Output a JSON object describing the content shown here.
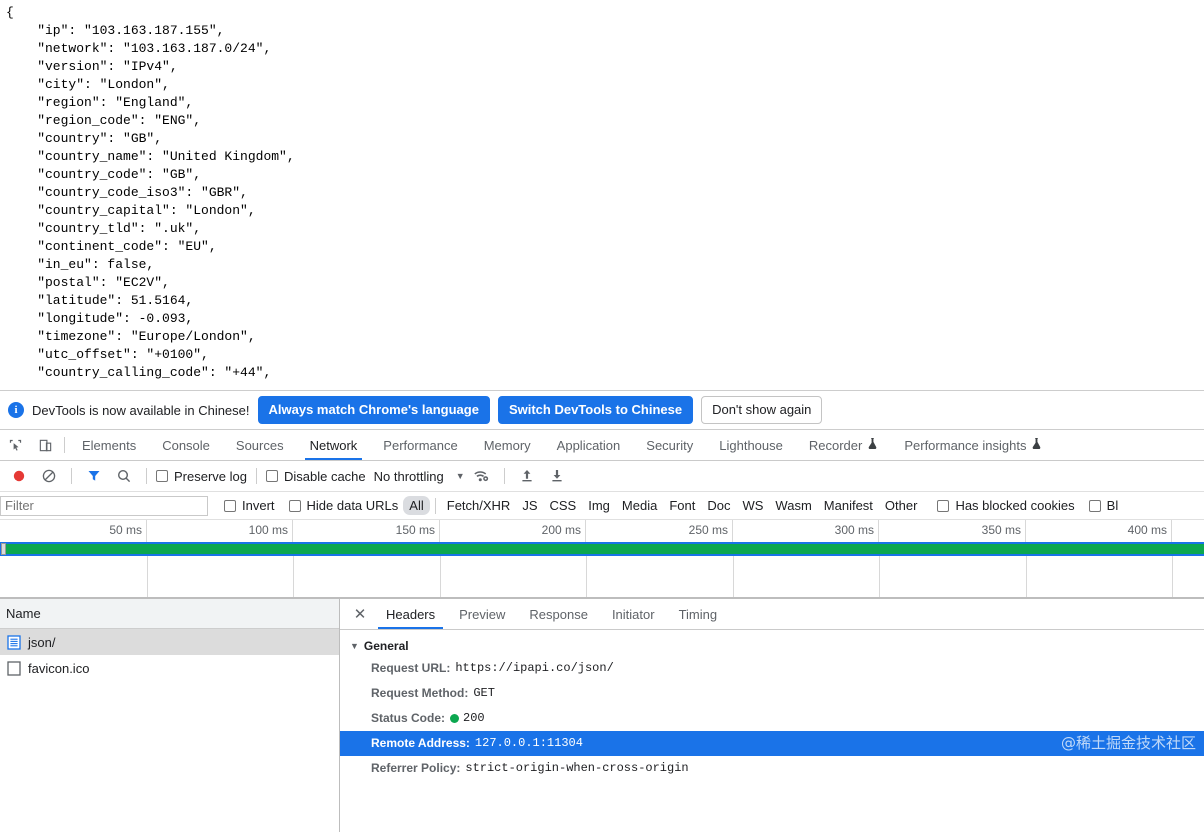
{
  "page": {
    "json_response": "{\n    \"ip\": \"103.163.187.155\",\n    \"network\": \"103.163.187.0/24\",\n    \"version\": \"IPv4\",\n    \"city\": \"London\",\n    \"region\": \"England\",\n    \"region_code\": \"ENG\",\n    \"country\": \"GB\",\n    \"country_name\": \"United Kingdom\",\n    \"country_code\": \"GB\",\n    \"country_code_iso3\": \"GBR\",\n    \"country_capital\": \"London\",\n    \"country_tld\": \".uk\",\n    \"continent_code\": \"EU\",\n    \"in_eu\": false,\n    \"postal\": \"EC2V\",\n    \"latitude\": 51.5164,\n    \"longitude\": -0.093,\n    \"timezone\": \"Europe/London\",\n    \"utc_offset\": \"+0100\",\n    \"country_calling_code\": \"+44\","
  },
  "infobar": {
    "icon": "info-icon",
    "message": "DevTools is now available in Chinese!",
    "primary_button": "Always match Chrome's language",
    "secondary_button": "Switch DevTools to Chinese",
    "dismiss_button": "Don't show again"
  },
  "devtools": {
    "left_icons": [
      "inspect-icon",
      "device-toolbar-icon"
    ],
    "tabs": [
      {
        "label": "Elements",
        "active": false,
        "flask": false
      },
      {
        "label": "Console",
        "active": false,
        "flask": false
      },
      {
        "label": "Sources",
        "active": false,
        "flask": false
      },
      {
        "label": "Network",
        "active": true,
        "flask": false
      },
      {
        "label": "Performance",
        "active": false,
        "flask": false
      },
      {
        "label": "Memory",
        "active": false,
        "flask": false
      },
      {
        "label": "Application",
        "active": false,
        "flask": false
      },
      {
        "label": "Security",
        "active": false,
        "flask": false
      },
      {
        "label": "Lighthouse",
        "active": false,
        "flask": false
      },
      {
        "label": "Recorder",
        "active": false,
        "flask": true
      },
      {
        "label": "Performance insights",
        "active": false,
        "flask": true
      }
    ]
  },
  "toolbar": {
    "record_icon": "record-stop-icon",
    "clear_icon": "clear-icon",
    "filter_icon": "filter-icon",
    "search_icon": "search-icon",
    "preserve_log_label": "Preserve log",
    "preserve_log_checked": false,
    "disable_cache_label": "Disable cache",
    "disable_cache_checked": false,
    "throttling_label": "No throttling",
    "throttling_caret": "▼",
    "network_conditions_icon": "wifi-settings-icon",
    "import_icon": "upload-arrow-icon",
    "export_icon": "download-arrow-icon"
  },
  "filterbar": {
    "filter_placeholder": "Filter",
    "filter_value": "",
    "invert_label": "Invert",
    "invert_checked": false,
    "hide_data_urls_label": "Hide data URLs",
    "hide_data_urls_checked": false,
    "types": [
      "All",
      "Fetch/XHR",
      "JS",
      "CSS",
      "Img",
      "Media",
      "Font",
      "Doc",
      "WS",
      "Wasm",
      "Manifest",
      "Other"
    ],
    "selected_type": "All",
    "has_blocked_cookies_label": "Has blocked cookies",
    "has_blocked_cookies_checked": false,
    "blocked_requests_label": "Bl",
    "blocked_requests_checked": false
  },
  "overview": {
    "ticks": [
      "50 ms",
      "100 ms",
      "150 ms",
      "200 ms",
      "250 ms",
      "300 ms",
      "350 ms",
      "400 ms"
    ],
    "band_color": "#0ca750",
    "selection_color": "#1a73e8"
  },
  "requests": {
    "column_header": "Name",
    "rows": [
      {
        "name": "json/",
        "icon": "document-icon",
        "selected": true
      },
      {
        "name": "favicon.ico",
        "icon": "generic-file-icon",
        "selected": false
      }
    ]
  },
  "details": {
    "close_label": "✕",
    "tabs": [
      {
        "label": "Headers",
        "active": true
      },
      {
        "label": "Preview",
        "active": false
      },
      {
        "label": "Response",
        "active": false
      },
      {
        "label": "Initiator",
        "active": false
      },
      {
        "label": "Timing",
        "active": false
      }
    ],
    "general_section": {
      "title": "General",
      "expanded": true,
      "rows": [
        {
          "key": "Request URL:",
          "value": "https://ipapi.co/json/",
          "highlight": false,
          "status_dot": false
        },
        {
          "key": "Request Method:",
          "value": "GET",
          "highlight": false,
          "status_dot": false
        },
        {
          "key": "Status Code:",
          "value": "200",
          "highlight": false,
          "status_dot": true
        },
        {
          "key": "Remote Address:",
          "value": "127.0.0.1:11304",
          "highlight": true,
          "status_dot": false
        },
        {
          "key": "Referrer Policy:",
          "value": "strict-origin-when-cross-origin",
          "highlight": false,
          "status_dot": false
        }
      ]
    },
    "watermark": "@稀土掘金技术社区"
  }
}
